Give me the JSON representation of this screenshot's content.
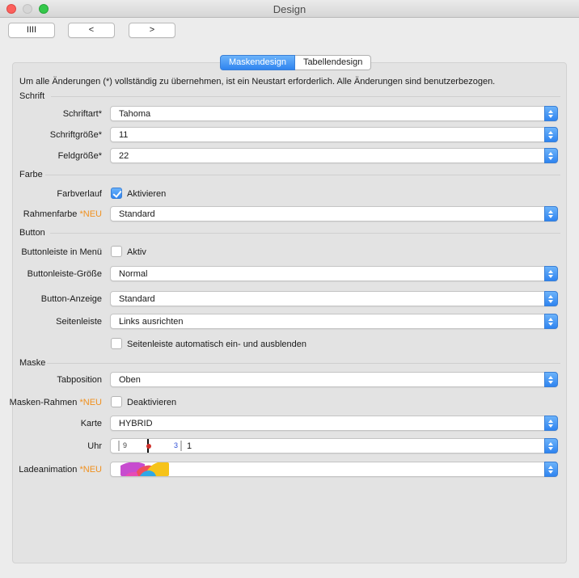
{
  "window": {
    "title": "Design"
  },
  "toolbar": {
    "btn1": "IIII",
    "btn2": "<",
    "btn3": ">"
  },
  "tabs": [
    {
      "label": "Maskendesign",
      "active": true
    },
    {
      "label": "Tabellendesign",
      "active": false
    }
  ],
  "notice": "Um alle Änderungen (*) vollständig zu übernehmen, ist ein Neustart erforderlich. Alle Änderungen sind benutzerbezogen.",
  "sections": {
    "schrift": "Schrift",
    "farbe": "Farbe",
    "button": "Button",
    "maske": "Maske"
  },
  "fields": {
    "schriftart": {
      "label": "Schriftart*",
      "value": "Tahoma"
    },
    "schriftgroesse": {
      "label": "Schriftgröße*",
      "value": "11"
    },
    "feldgroesse": {
      "label": "Feldgröße*",
      "value": "22"
    },
    "farbverlauf": {
      "label": "Farbverlauf",
      "checkbox_label": "Aktivieren",
      "checked": true
    },
    "rahmenfarbe": {
      "label": "Rahmenfarbe",
      "neu": "*NEU",
      "value": "Standard"
    },
    "buttonleiste_menu": {
      "label": "Buttonleiste in Menü",
      "checkbox_label": "Aktiv",
      "checked": false
    },
    "buttonleiste_groesse": {
      "label": "Buttonleiste-Größe",
      "value": "Normal"
    },
    "button_anzeige": {
      "label": "Button-Anzeige",
      "value": "Standard"
    },
    "seitenleiste": {
      "label": "Seitenleiste",
      "value": "Links ausrichten"
    },
    "seitenleiste_auto": {
      "checkbox_label": "Seitenleiste automatisch ein- und ausblenden",
      "checked": false
    },
    "tabposition": {
      "label": "Tabposition",
      "value": "Oben"
    },
    "masken_rahmen": {
      "label": "Masken-Rahmen",
      "neu": "*NEU",
      "checkbox_label": "Deaktivieren",
      "checked": false
    },
    "karte": {
      "label": "Karte",
      "value": "HYBRID"
    },
    "uhr": {
      "label": "Uhr",
      "clock_left": "9",
      "clock_right": "3",
      "value": "1"
    },
    "ladeanimation": {
      "label": "Ladeanimation",
      "neu": "*NEU"
    }
  },
  "colors": {
    "accent": "#2f84f0",
    "neu": "#f0901e"
  },
  "icons": {
    "select_arrow": "updown-chevron-icon",
    "check": "checkmark-icon"
  }
}
